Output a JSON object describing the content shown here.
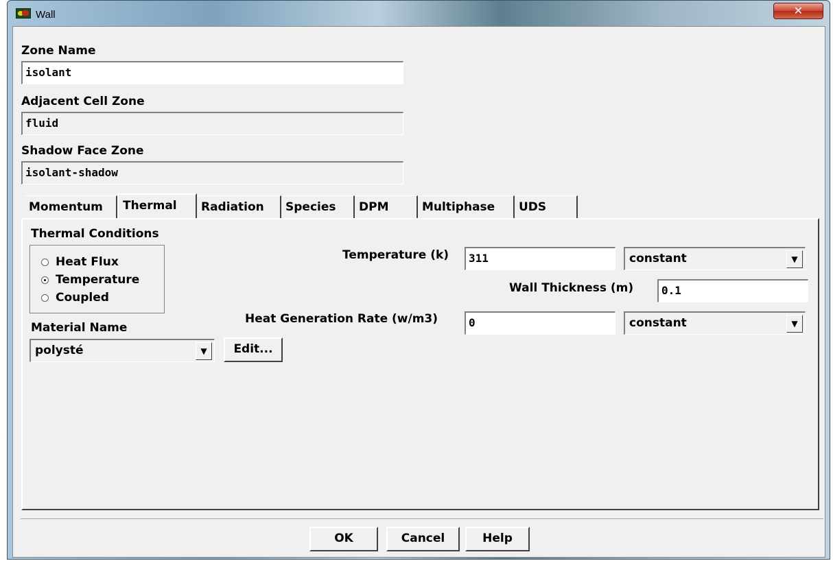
{
  "window": {
    "title": "Wall",
    "close_glyph": "✕"
  },
  "zone_name": {
    "label": "Zone Name",
    "value": "isolant"
  },
  "adjacent_cell_zone": {
    "label": "Adjacent Cell Zone",
    "value": "fluid"
  },
  "shadow_face_zone": {
    "label": "Shadow Face Zone",
    "value": "isolant-shadow"
  },
  "tabs": [
    {
      "label": "Momentum",
      "active": false
    },
    {
      "label": "Thermal",
      "active": true
    },
    {
      "label": "Radiation",
      "active": false
    },
    {
      "label": "Species",
      "active": false
    },
    {
      "label": "DPM",
      "active": false
    },
    {
      "label": "Multiphase",
      "active": false
    },
    {
      "label": "UDS",
      "active": false
    }
  ],
  "thermal": {
    "conditions_label": "Thermal Conditions",
    "options": [
      {
        "label": "Heat Flux",
        "selected": false
      },
      {
        "label": "Temperature",
        "selected": true
      },
      {
        "label": "Coupled",
        "selected": false
      }
    ],
    "temperature": {
      "label": "Temperature (k)",
      "value": "311",
      "profile": "constant"
    },
    "wall_thickness": {
      "label": "Wall Thickness (m)",
      "value": "0.1"
    },
    "heat_generation": {
      "label": "Heat Generation Rate (w/m3)",
      "value": "0",
      "profile": "constant"
    },
    "material": {
      "label": "Material Name",
      "value": "polysté",
      "edit_label": "Edit..."
    }
  },
  "buttons": {
    "ok": "OK",
    "cancel": "Cancel",
    "help": "Help"
  },
  "icons": {
    "dropdown": "chevron-down-icon",
    "app": "app-icon"
  }
}
